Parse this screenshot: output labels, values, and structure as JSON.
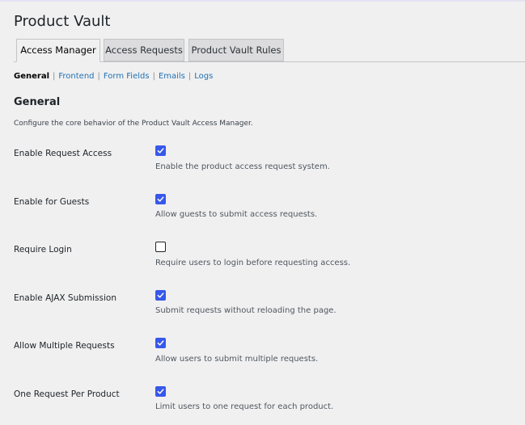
{
  "page": {
    "title": "Product Vault"
  },
  "tabs": [
    {
      "label": "Access Manager",
      "active": true
    },
    {
      "label": "Access Requests",
      "active": false
    },
    {
      "label": "Product Vault Rules",
      "active": false
    }
  ],
  "subnav": {
    "items": [
      {
        "label": "General",
        "current": true
      },
      {
        "label": "Frontend",
        "current": false
      },
      {
        "label": "Form Fields",
        "current": false
      },
      {
        "label": "Emails",
        "current": false
      },
      {
        "label": "Logs",
        "current": false
      }
    ],
    "separator": "|"
  },
  "section": {
    "title": "General",
    "description": "Configure the core behavior of the Product Vault Access Manager."
  },
  "settings": [
    {
      "label": "Enable Request Access",
      "checked": true,
      "description": "Enable the product access request system."
    },
    {
      "label": "Enable for Guests",
      "checked": true,
      "description": "Allow guests to submit access requests."
    },
    {
      "label": "Require Login",
      "checked": false,
      "description": "Require users to login before requesting access."
    },
    {
      "label": "Enable AJAX Submission",
      "checked": true,
      "description": "Submit requests without reloading the page."
    },
    {
      "label": "Allow Multiple Requests",
      "checked": true,
      "description": "Allow users to submit multiple requests."
    },
    {
      "label": "One Request Per Product",
      "checked": true,
      "description": "Limit users to one request for each product."
    }
  ],
  "colors": {
    "checkbox_accent": "#3858e9",
    "link": "#2271b1",
    "background": "#f0f0f1"
  },
  "icons": {
    "checkmark": "checkmark-icon"
  }
}
